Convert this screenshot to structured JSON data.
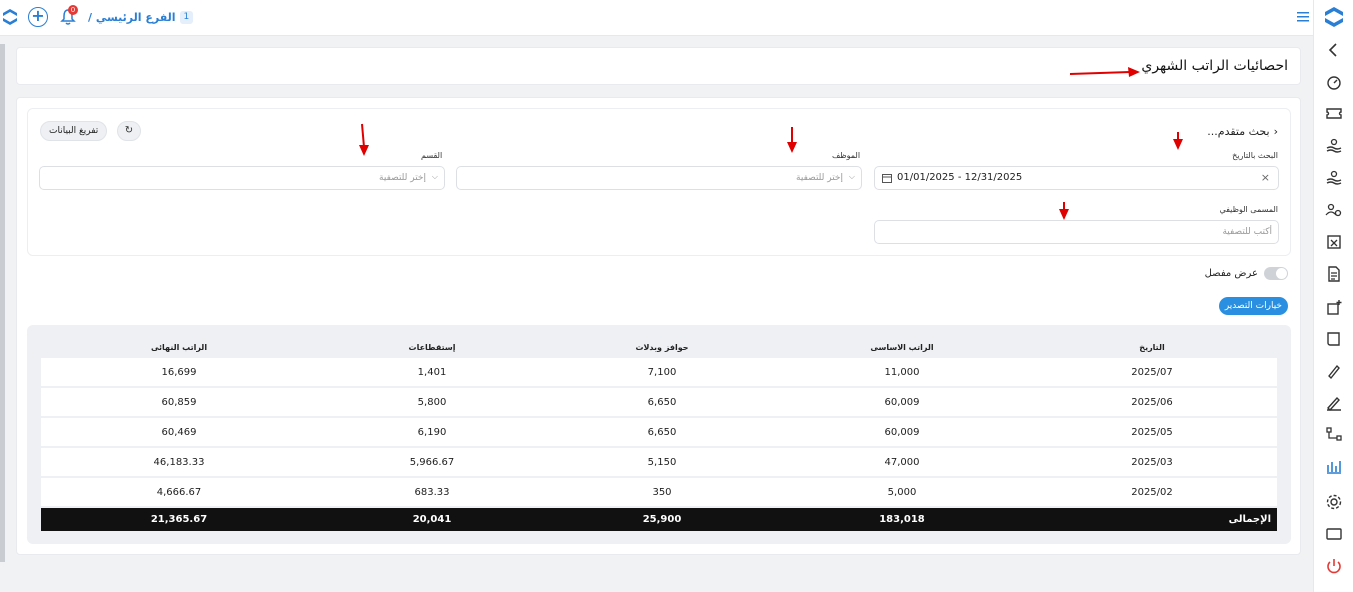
{
  "topbar": {
    "branch_name": "الفرع الرئيسي /",
    "branch_number": "1",
    "notification_count": "0"
  },
  "page": {
    "title": "احصائيات الراتب الشهري"
  },
  "filters": {
    "advanced_search": "بحث متقدم...",
    "clear_button": "تفريغ البيانات",
    "date_label": "البحث بالتاريخ",
    "date_value": "01/01/2025 - 12/31/2025",
    "employee_label": "الموظف",
    "employee_placeholder": "إختر للتصفية",
    "department_label": "القسم",
    "department_placeholder": "إختر للتصفية",
    "job_title_label": "المسمى الوظيفي",
    "job_title_placeholder": "أكتب للتصفية"
  },
  "detail_toggle": {
    "label": "عرض مفصل",
    "on": false
  },
  "export_button": "خيارات التصدير",
  "table": {
    "headers": {
      "date": "التاريخ",
      "basic": "الراتب الاساسى",
      "allowances": "حوافز وبدلات",
      "deductions": "إستقطاعات",
      "final": "الراتب النهائى"
    },
    "rows": [
      {
        "date": "2025/07",
        "basic": "11,000",
        "allowances": "7,100",
        "deductions": "1,401",
        "final": "16,699"
      },
      {
        "date": "2025/06",
        "basic": "60,009",
        "allowances": "6,650",
        "deductions": "5,800",
        "final": "60,859"
      },
      {
        "date": "2025/05",
        "basic": "60,009",
        "allowances": "6,650",
        "deductions": "6,190",
        "final": "60,469"
      },
      {
        "date": "2025/03",
        "basic": "47,000",
        "allowances": "5,150",
        "deductions": "5,966.67",
        "final": "46,183.33"
      },
      {
        "date": "2025/02",
        "basic": "5,000",
        "allowances": "350",
        "deductions": "683.33",
        "final": "4,666.67"
      }
    ],
    "totals": {
      "label": "الإجمالى",
      "basic": "183,018",
      "allowances": "25,900",
      "deductions": "20,041",
      "final": "21,365.67"
    }
  },
  "colors": {
    "accent": "#2a7fd4",
    "annotation": "#e00000",
    "total_row": "#111111"
  },
  "sidebar_icons": [
    "chevron-left-icon",
    "dashboard-icon",
    "ticket-icon",
    "hand-money-icon",
    "hand-money-2-icon",
    "users-gear-icon",
    "document-x-icon",
    "document-icon",
    "box-add-icon",
    "book-icon",
    "pen-check-icon",
    "signature-icon",
    "hierarchy-icon",
    "bar-chart-icon",
    "gear-icon",
    "monitor-icon",
    "power-icon"
  ]
}
